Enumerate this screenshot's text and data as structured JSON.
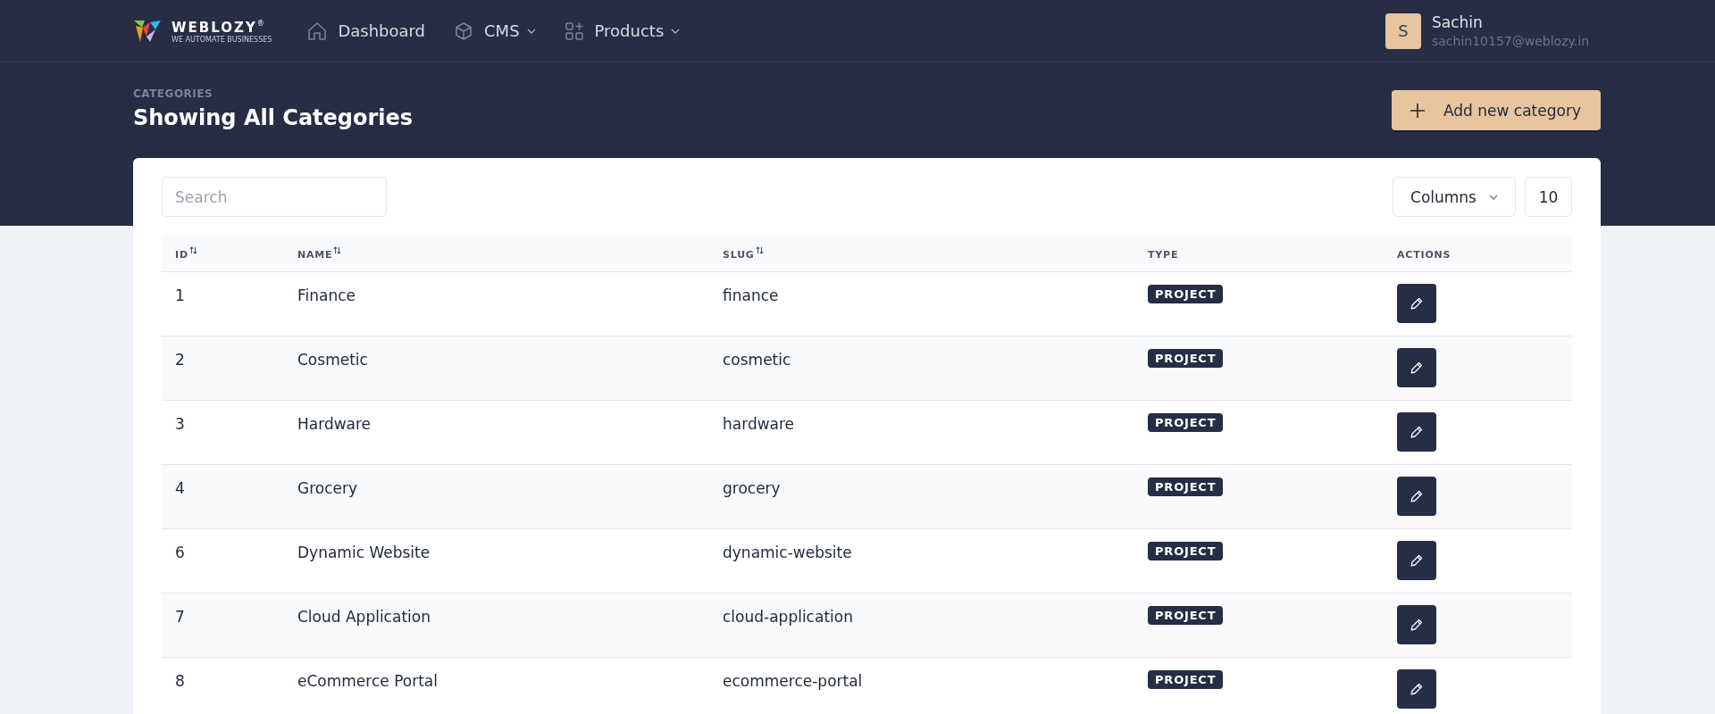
{
  "header": {
    "logo": {
      "name": "WEBLOZY",
      "mark": "®",
      "tagline": "WE AUTOMATE BUSINESSES"
    },
    "nav": [
      {
        "label": "Dashboard",
        "dropdown": false
      },
      {
        "label": "CMS",
        "dropdown": true
      },
      {
        "label": "Products",
        "dropdown": true
      }
    ],
    "user": {
      "initial": "S",
      "name": "Sachin",
      "email": "sachin10157@weblozy.in"
    }
  },
  "page": {
    "breadcrumb": "CATEGORIES",
    "title": "Showing All Categories",
    "add_button": "Add new category"
  },
  "toolbar": {
    "search": {
      "placeholder": "Search"
    },
    "columns_button": "Columns",
    "page_size": "10"
  },
  "table": {
    "columns": [
      {
        "label": "ID",
        "sortable": true
      },
      {
        "label": "NAME",
        "sortable": true
      },
      {
        "label": "SLUG",
        "sortable": true
      },
      {
        "label": "TYPE",
        "sortable": false
      },
      {
        "label": "ACTIONS",
        "sortable": false
      }
    ],
    "rows": [
      {
        "id": "1",
        "name": "Finance",
        "slug": "finance",
        "type": "PROJECT"
      },
      {
        "id": "2",
        "name": "Cosmetic",
        "slug": "cosmetic",
        "type": "PROJECT"
      },
      {
        "id": "3",
        "name": "Hardware",
        "slug": "hardware",
        "type": "PROJECT"
      },
      {
        "id": "4",
        "name": "Grocery",
        "slug": "grocery",
        "type": "PROJECT"
      },
      {
        "id": "6",
        "name": "Dynamic Website",
        "slug": "dynamic-website",
        "type": "PROJECT"
      },
      {
        "id": "7",
        "name": "Cloud Application",
        "slug": "cloud-application",
        "type": "PROJECT"
      },
      {
        "id": "8",
        "name": "eCommerce Portal",
        "slug": "ecommerce-portal",
        "type": "PROJECT"
      }
    ]
  }
}
